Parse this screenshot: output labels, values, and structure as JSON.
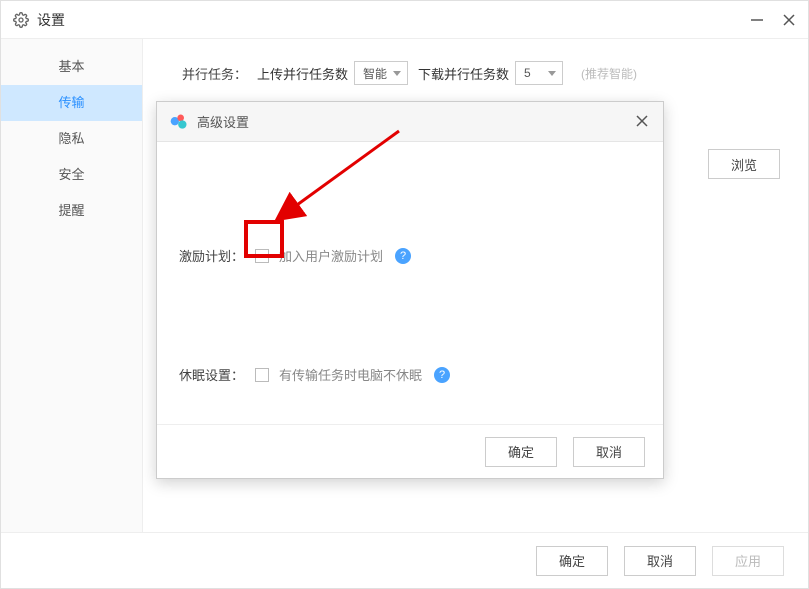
{
  "window": {
    "title": "设置",
    "controls": {
      "minimize": "minimize",
      "close": "close"
    }
  },
  "sidebar": {
    "items": [
      {
        "label": "基本",
        "active": false
      },
      {
        "label": "传输",
        "active": true
      },
      {
        "label": "隐私",
        "active": false
      },
      {
        "label": "安全",
        "active": false
      },
      {
        "label": "提醒",
        "active": false
      }
    ]
  },
  "content": {
    "parallel_label": "并行任务：",
    "upload_label": "上传并行任务数",
    "upload_value": "智能",
    "download_label": "下载并行任务数",
    "download_value": "5",
    "hint": "(推荐智能)",
    "browse": "浏览"
  },
  "dialog": {
    "title": "高级设置",
    "row1_label": "激励计划：",
    "row1_chk_label": "加入用户激励计划",
    "row2_label": "休眠设置：",
    "row2_chk_label": "有传输任务时电脑不休眠",
    "help": "?",
    "ok": "确定",
    "cancel": "取消"
  },
  "footer": {
    "ok": "确定",
    "cancel": "取消",
    "apply": "应用"
  }
}
